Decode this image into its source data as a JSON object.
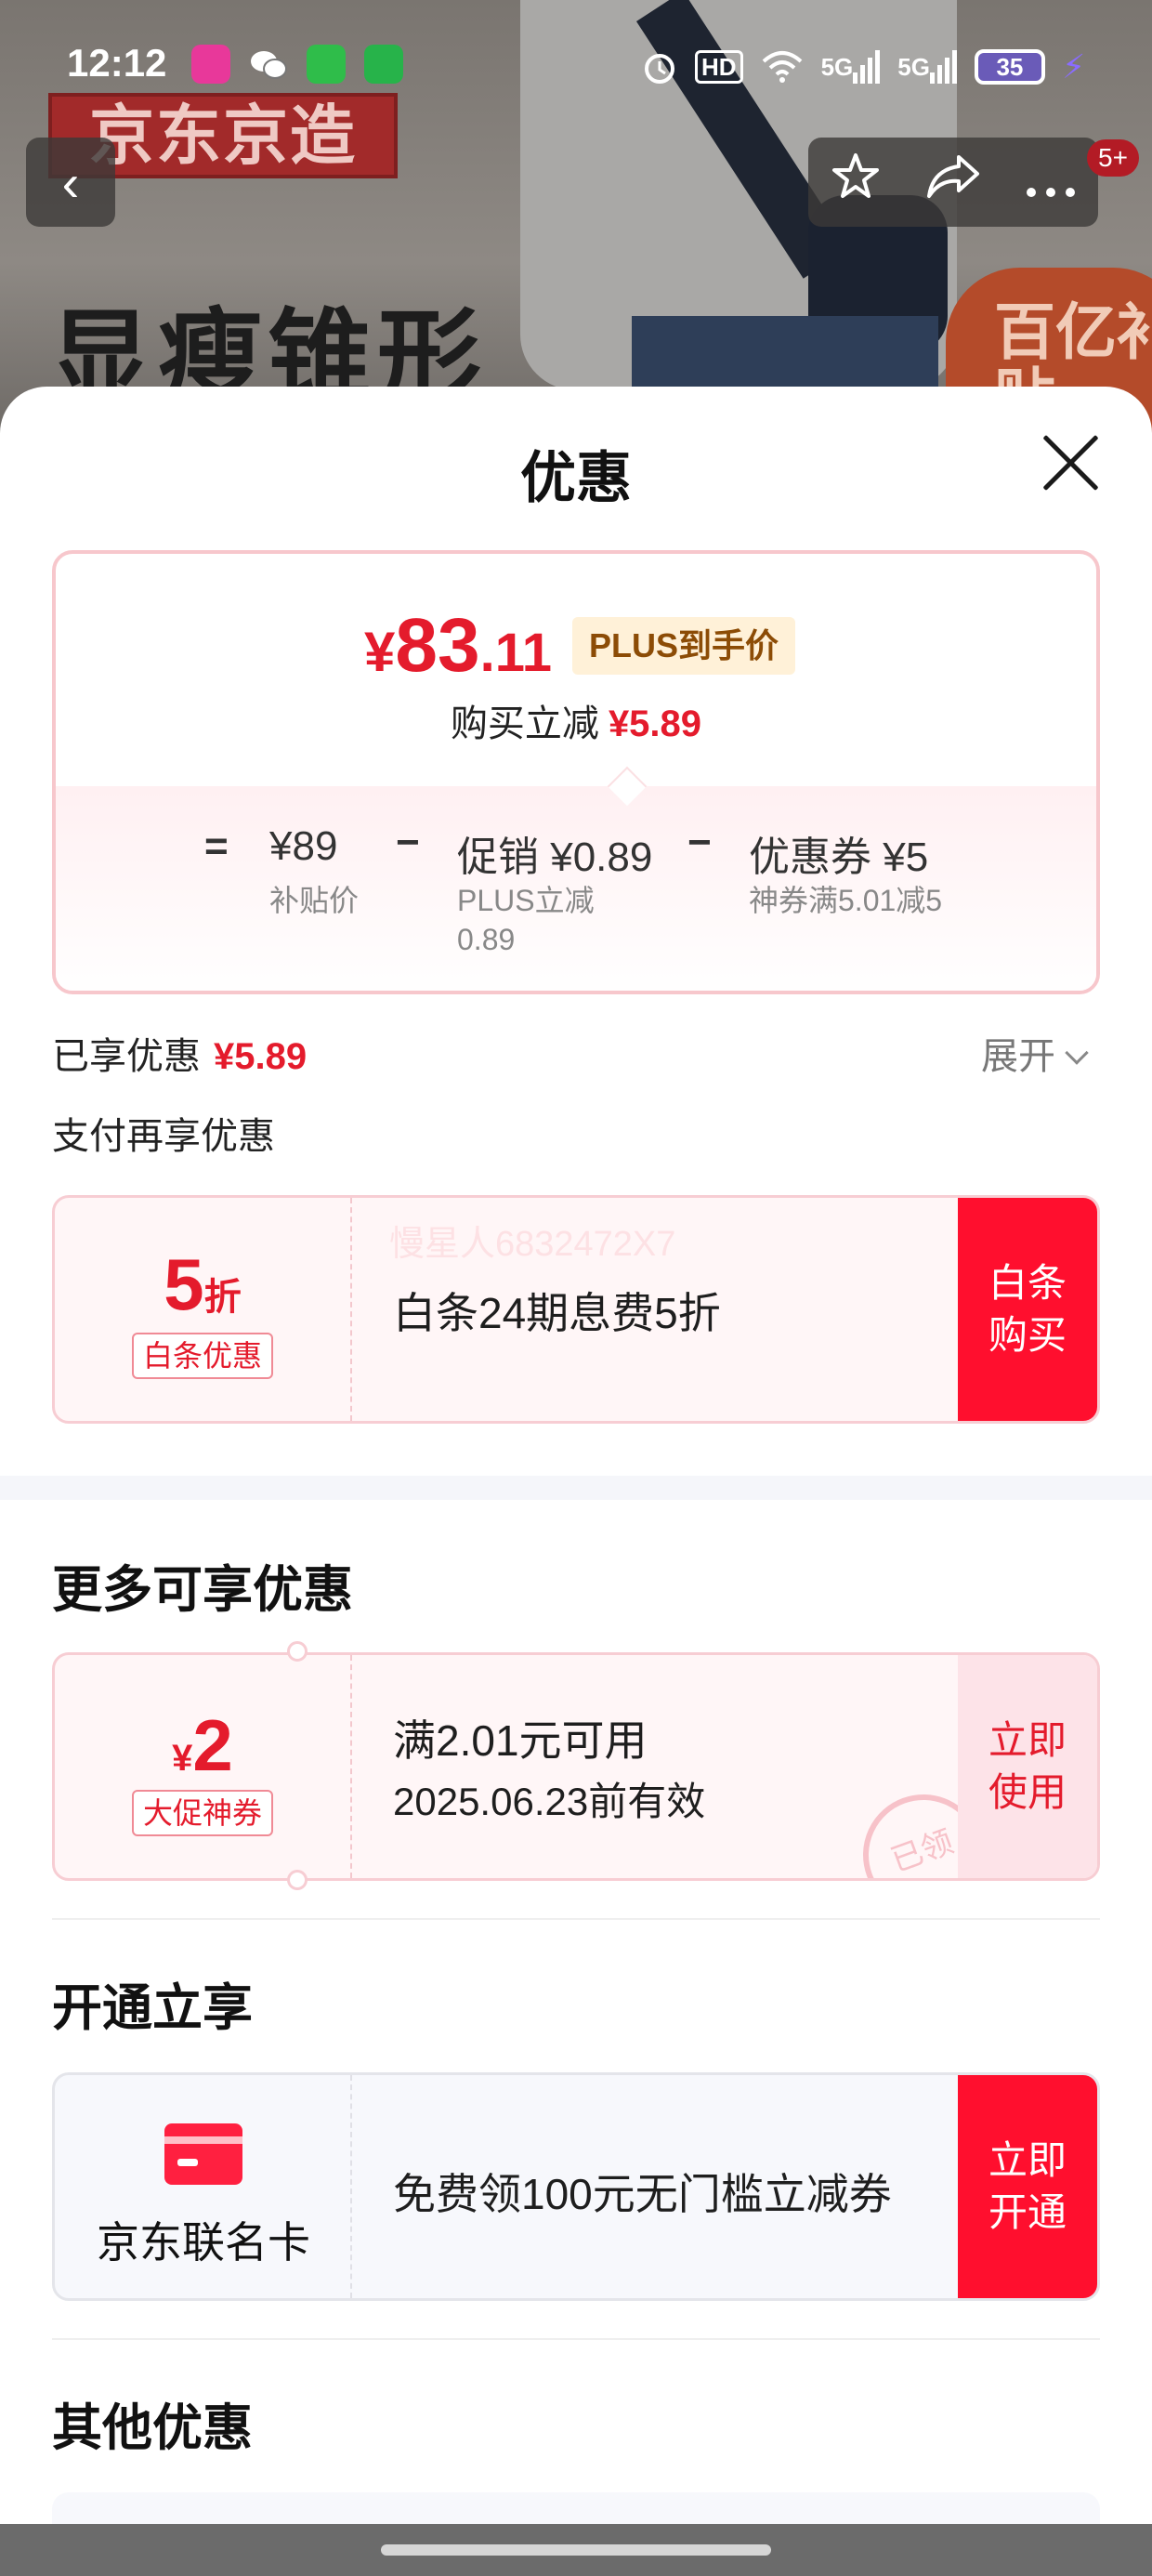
{
  "status_bar": {
    "time": "12:12",
    "network1": "5G",
    "network2": "5G",
    "hd": "HD",
    "battery": "35"
  },
  "background_page": {
    "brand_banner": "京东京造",
    "slogan": "显瘦锥形",
    "subsidy_badge": "百亿补贴",
    "cart_count": "5+",
    "back_icon": "chevron-left-icon",
    "favorite_icon": "star-icon",
    "share_icon": "share-icon",
    "more_icon": "more-icon"
  },
  "sheet": {
    "title": "优惠",
    "close_icon": "close-icon"
  },
  "price_card": {
    "currency": "¥",
    "price_int": "83",
    "price_dec": ".11",
    "plus_tag": "PLUS到手价",
    "instant_label": "购买立减",
    "instant_value": "¥5.89",
    "equals": "=",
    "minus": "−",
    "base_price": "¥89",
    "base_price_label": "补贴价",
    "promo_label": "促销",
    "promo_value": "¥0.89",
    "promo_sub_line1": "PLUS立减",
    "promo_sub_line2": "0.89",
    "coupon_label": "优惠券",
    "coupon_value": "¥5",
    "coupon_sub": "神券满5.01减5"
  },
  "enjoyed": {
    "label": "已享优惠",
    "value": "¥5.89",
    "expand_label": "展开",
    "pay_more_label": "支付再享优惠"
  },
  "baitiao_coupon": {
    "discount_num": "5",
    "discount_unit": "折",
    "tag": "白条优惠",
    "watermark": "慢星人6832472X7",
    "description": "白条24期息费5折",
    "button": "白条购买"
  },
  "more_section": {
    "title": "更多可享优惠",
    "coupon": {
      "currency": "¥",
      "amount": "2",
      "tag": "大促神券",
      "condition": "满2.01元可用",
      "validity": "2025.06.23前有效",
      "stamp": "已领",
      "button": "立即使用"
    }
  },
  "open_section": {
    "title": "开通立享",
    "card": {
      "icon": "credit-card-icon",
      "label": "京东联名卡",
      "description": "免费领100元无门槛立减券",
      "button": "立即开通"
    }
  },
  "other_section": {
    "title": "其他优惠"
  }
}
